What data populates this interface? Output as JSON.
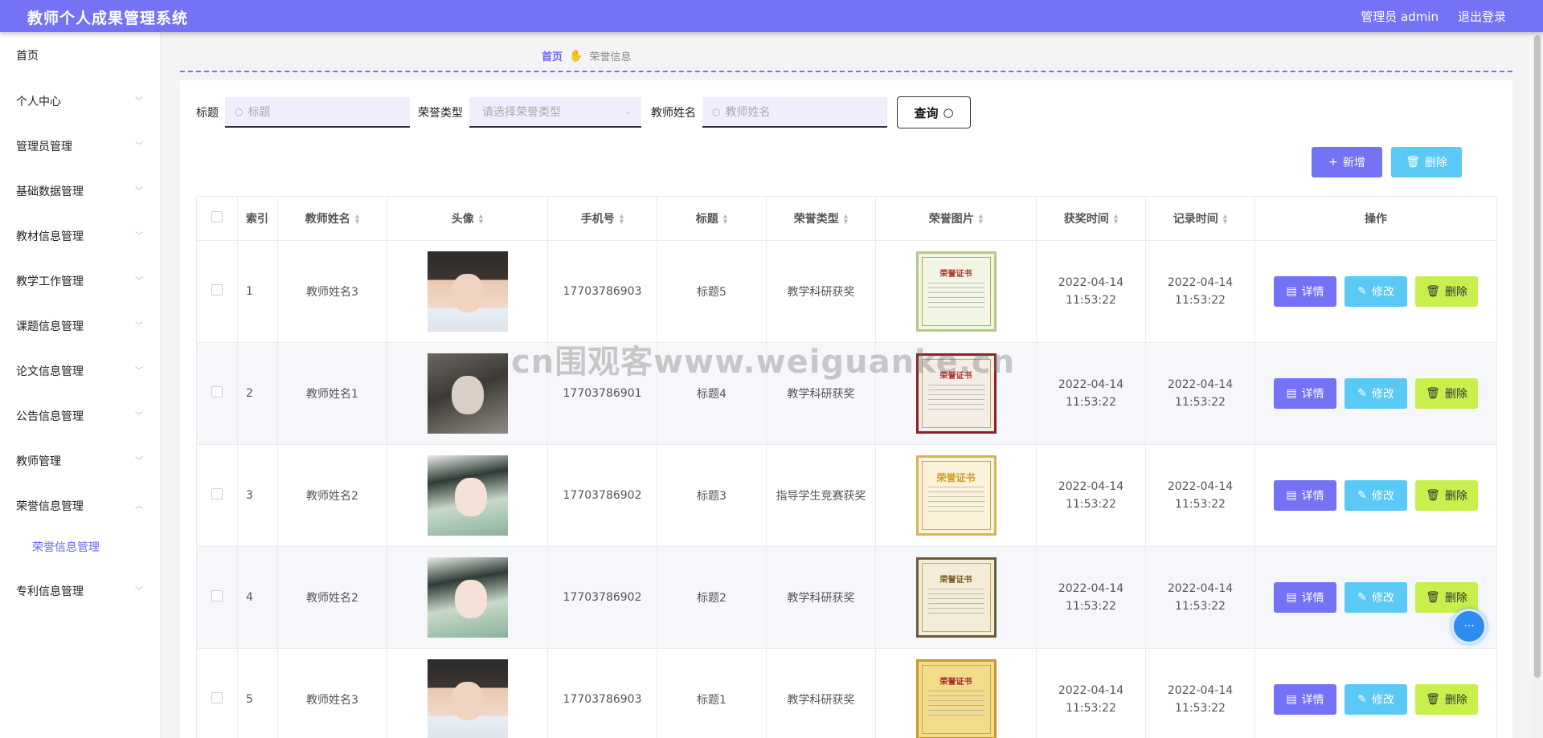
{
  "header": {
    "app_title": "教师个人成果管理系统",
    "user_label": "管理员 admin",
    "logout_label": "退出登录"
  },
  "sidebar": {
    "items": [
      {
        "label": "首页",
        "has_children": false
      },
      {
        "label": "个人中心",
        "has_children": true
      },
      {
        "label": "管理员管理",
        "has_children": true
      },
      {
        "label": "基础数据管理",
        "has_children": true
      },
      {
        "label": "教材信息管理",
        "has_children": true
      },
      {
        "label": "教学工作管理",
        "has_children": true
      },
      {
        "label": "课题信息管理",
        "has_children": true
      },
      {
        "label": "论文信息管理",
        "has_children": true
      },
      {
        "label": "公告信息管理",
        "has_children": true
      },
      {
        "label": "教师管理",
        "has_children": true
      },
      {
        "label": "荣誉信息管理",
        "has_children": true,
        "expanded": true
      },
      {
        "label": "专利信息管理",
        "has_children": true
      }
    ],
    "active_sub": "荣誉信息管理"
  },
  "breadcrumb": {
    "home": "首页",
    "current": "荣誉信息"
  },
  "search": {
    "title_label": "标题",
    "title_placeholder": "标题",
    "type_label": "荣誉类型",
    "type_placeholder": "请选择荣誉类型",
    "teacher_label": "教师姓名",
    "teacher_placeholder": "教师姓名",
    "query_label": "查询"
  },
  "actions": {
    "add_label": "新增",
    "delete_label": "删除"
  },
  "table": {
    "columns": [
      "索引",
      "教师姓名",
      "头像",
      "手机号",
      "标题",
      "荣誉类型",
      "荣誉图片",
      "获奖时间",
      "记录时间",
      "操作"
    ],
    "rows": [
      {
        "index": "1",
        "teacher": "教师姓名3",
        "avatar": "avatar-male",
        "phone": "17703786903",
        "title": "标题5",
        "type": "教学科研获奖",
        "cert": "荣誉证书",
        "award_time": "2022-04-14 11:53:22",
        "record_time": "2022-04-14 11:53:22"
      },
      {
        "index": "2",
        "teacher": "教师姓名1",
        "avatar": "avatar-male-coat",
        "phone": "17703786901",
        "title": "标题4",
        "type": "教学科研获奖",
        "cert": "荣誉证书",
        "award_time": "2022-04-14 11:53:22",
        "record_time": "2022-04-14 11:53:22"
      },
      {
        "index": "3",
        "teacher": "教师姓名2",
        "avatar": "avatar-female",
        "phone": "17703786902",
        "title": "标题3",
        "type": "指导学生竞赛获奖",
        "cert": "荣誉证书",
        "award_time": "2022-04-14 11:53:22",
        "record_time": "2022-04-14 11:53:22"
      },
      {
        "index": "4",
        "teacher": "教师姓名2",
        "avatar": "avatar-female",
        "phone": "17703786902",
        "title": "标题2",
        "type": "教学科研获奖",
        "cert": "荣誉证书",
        "award_time": "2022-04-14 11:53:22",
        "record_time": "2022-04-14 11:53:22"
      },
      {
        "index": "5",
        "teacher": "教师姓名3",
        "avatar": "avatar-male",
        "phone": "17703786903",
        "title": "标题1",
        "type": "教学科研获奖",
        "cert": "荣誉证书",
        "award_time": "2022-04-14 11:53:22",
        "record_time": "2022-04-14 11:53:22"
      }
    ],
    "row_actions": {
      "detail": "详情",
      "edit": "修改",
      "delete": "删除"
    }
  },
  "watermark": "cn围观客www.weiguanke.cn",
  "colors": {
    "primary": "#7472f5",
    "info": "#5bc9f5",
    "lime": "#c8f04c"
  }
}
